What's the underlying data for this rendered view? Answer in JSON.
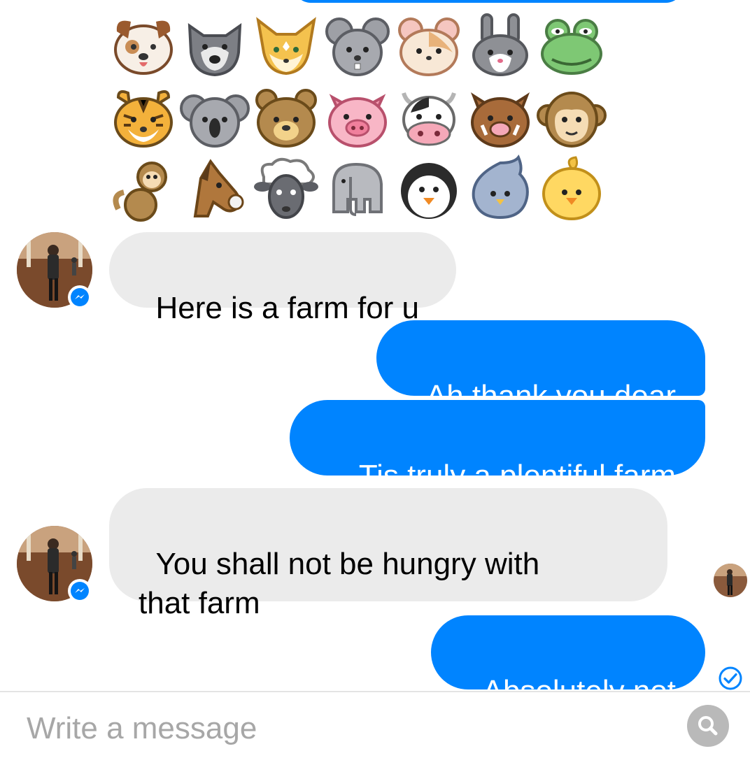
{
  "colors": {
    "outgoing_bubble": "#0084ff",
    "incoming_bubble": "#ebebeb",
    "messenger_blue": "#0084ff",
    "placeholder_text": "#a7a7a7"
  },
  "sticker": {
    "rows": [
      [
        "dog-face-icon",
        "wolf-face-icon",
        "fox-face-icon",
        "mouse-face-icon",
        "hamster-face-icon",
        "rabbit-face-icon",
        "frog-face-icon"
      ],
      [
        "tiger-face-icon",
        "koala-face-icon",
        "bear-face-icon",
        "pig-face-icon",
        "cow-face-icon",
        "boar-face-icon",
        "monkey-face-icon"
      ],
      [
        "monkey-icon",
        "horse-face-icon",
        "sheep-face-icon",
        "elephant-icon",
        "penguin-icon",
        "bird-icon",
        "chick-icon"
      ]
    ]
  },
  "messages": [
    {
      "direction": "incoming",
      "text": "Here is a farm for u"
    },
    {
      "direction": "outgoing",
      "text": "Ah thank you dear"
    },
    {
      "direction": "outgoing",
      "text": "Tis truly a plentiful farm"
    },
    {
      "direction": "incoming",
      "text": "You shall not be hungry with\nthat farm"
    },
    {
      "direction": "outgoing",
      "text": "Absolutely not"
    }
  ],
  "status": {
    "seen_icon": "seen-avatar-icon",
    "sent_icon": "check-circle-icon"
  },
  "composer": {
    "placeholder": "Write a message",
    "value": "",
    "action_icon": "search-icon"
  }
}
